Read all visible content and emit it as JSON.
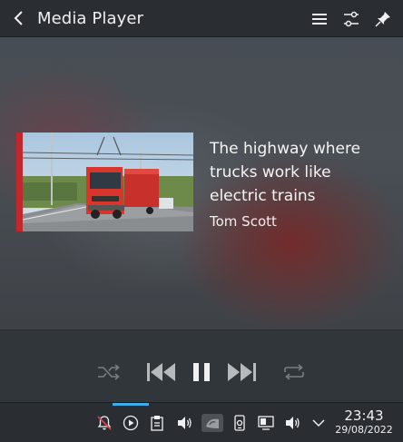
{
  "header": {
    "title": "Media Player",
    "icons": [
      "back-arrow",
      "hamburger-menu",
      "sliders",
      "pin"
    ]
  },
  "now_playing": {
    "title": "The highway where trucks work like electric trains",
    "artist": "Tom Scott",
    "cover_accent": "#c1272d"
  },
  "controls": {
    "icons": [
      "shuffle",
      "skip-previous",
      "pause",
      "skip-next",
      "repeat"
    ]
  },
  "taskbar": {
    "tray_icons": [
      "notifications-disabled",
      "media-player",
      "clipboard",
      "volume",
      "nvidia",
      "kde-connect",
      "display",
      "audio",
      "expand-arrow"
    ],
    "time": "23:43",
    "date": "29/08/2022",
    "accent": "#3daee9"
  }
}
